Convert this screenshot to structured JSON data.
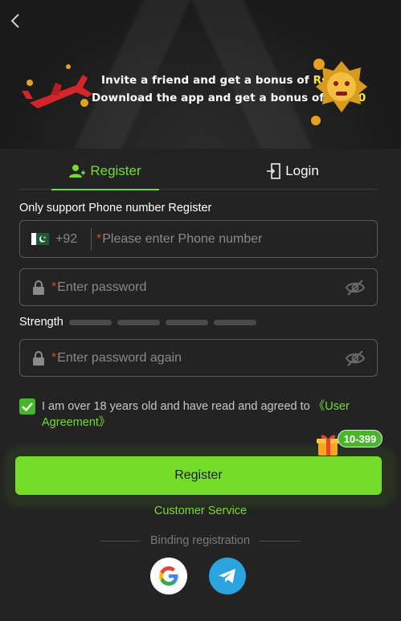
{
  "nav": {
    "back_icon": "chevron-left-icon"
  },
  "banner": {
    "line1_prefix": "Invite a friend and get a bonus of ",
    "line1_amount": "Rs600",
    "line2_prefix": "Download the app and get a bonus of ",
    "line2_amount": "Rs100"
  },
  "tabs": {
    "register_label": "Register",
    "login_label": "Login",
    "active": "register"
  },
  "form": {
    "support_note": "Only support Phone number Register",
    "phone": {
      "country_code": "+92",
      "placeholder": "Please enter Phone number",
      "required_mark": "*"
    },
    "password": {
      "placeholder": "Enter password",
      "required_mark": "*"
    },
    "strength_label": "Strength",
    "strength_segments": 4,
    "password_again": {
      "placeholder": "Enter password again",
      "required_mark": "*"
    },
    "agreement": {
      "checked": true,
      "text": "I am over 18 years old and have read and agreed to ",
      "link": "《User Agreement》"
    },
    "submit_label": "Register",
    "bonus_badge": "10-399"
  },
  "footer": {
    "customer_service": "Customer Service",
    "binding_label": "Binding registration",
    "social": [
      "google-icon",
      "telegram-icon"
    ]
  },
  "colors": {
    "accent": "#76dc2a",
    "background": "#232323",
    "required": "#e0433b",
    "banner_highlight": "#f7e24a"
  }
}
